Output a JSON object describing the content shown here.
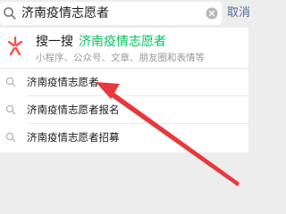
{
  "search": {
    "query": "济南疫情志愿者",
    "cancel_label": "取消",
    "icon": "search-icon",
    "clear_icon": "clear-circle-icon"
  },
  "souyisou": {
    "prefix": "搜一搜",
    "keyword": "济南疫情志愿者",
    "description": "小程序、公众号、文章、朋友圈和表情等",
    "logo_icon": "souyisou-logo-icon",
    "keyword_color": "#07c160"
  },
  "suggestions": [
    {
      "label": "济南疫情志愿者",
      "icon": "search-icon"
    },
    {
      "label": "济南疫情志愿者报名",
      "icon": "search-icon"
    },
    {
      "label": "济南疫情志愿者招募",
      "icon": "search-icon"
    }
  ],
  "annotation": {
    "color": "#e8383d",
    "type": "red-arrow",
    "target": "suggestion-1"
  },
  "colors": {
    "background": "#ededed",
    "link": "#576b95",
    "muted": "#9a9a9a"
  }
}
